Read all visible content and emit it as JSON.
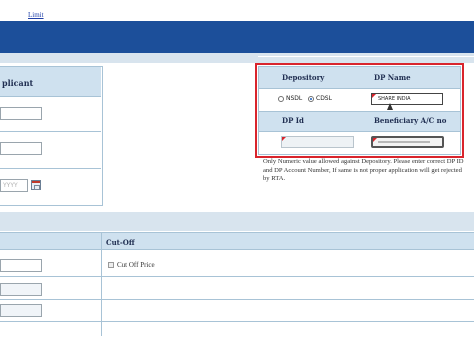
{
  "top_link": "Limit",
  "applicant": {
    "header_fragment": "plicant",
    "date_placeholder": "YYYY"
  },
  "depository": {
    "col_depository": "Depository",
    "col_dp_name": "DP Name",
    "col_dp_id": "DP Id",
    "col_beneficiary": "Beneficiary A/C no",
    "radio_nsdl": "NSDL",
    "radio_cdsl": "CDSL",
    "selected": "CDSL",
    "dp_name_value": "SHARE INDIA"
  },
  "note": "Only Numeric value allowed against Depository. Please enter correct DP ID and DP Account Number, If same is not proper application will get rejected by RTA.",
  "bid": {
    "col_cutoff": "Cut-Off",
    "cutoff_label": "Cut Off Price"
  },
  "colors": {
    "top_bar": "#1c4f9a",
    "header_bg": "#cfe1ef",
    "highlight_frame": "#d9242c"
  }
}
